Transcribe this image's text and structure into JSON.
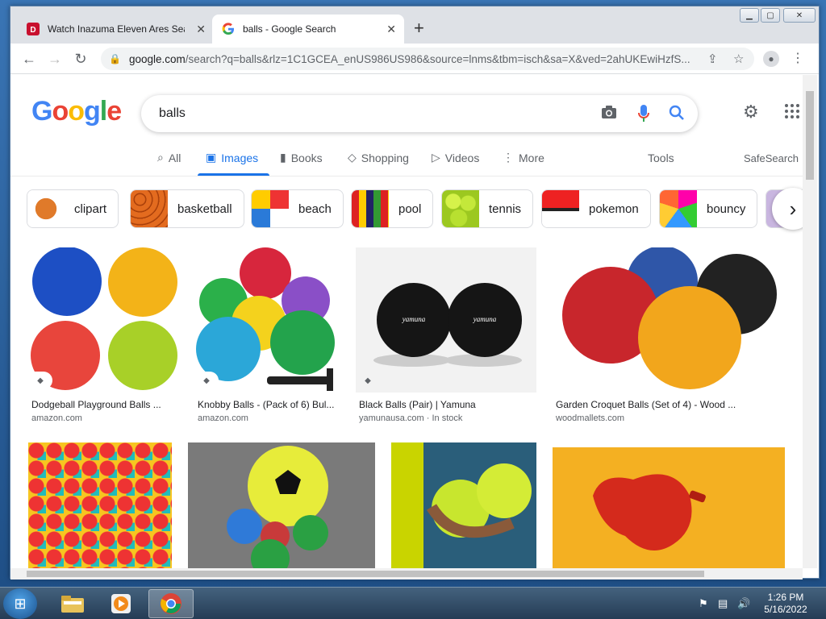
{
  "tabs": [
    {
      "title": "Watch Inazuma Eleven Ares Seas"
    },
    {
      "title": "balls - Google Search"
    }
  ],
  "address_bar": {
    "url_host": "google.com",
    "url_rest": "/search?q=balls&rlz=1C1GCEA_enUS986US986&source=lnms&tbm=isch&sa=X&ved=2ahUKEwiHzfS..."
  },
  "search": {
    "query": "balls"
  },
  "nav_tabs": [
    "All",
    "Images",
    "Books",
    "Shopping",
    "Videos",
    "More"
  ],
  "tools_label": "Tools",
  "safesearch_label": "SafeSearch",
  "chips": [
    "clipart",
    "basketball",
    "beach",
    "pool",
    "tennis",
    "pokemon",
    "bouncy"
  ],
  "results": [
    {
      "title": "Dodgeball Playground Balls ...",
      "source": "amazon.com"
    },
    {
      "title": "Knobby Balls - (Pack of 6) Bul...",
      "source": "amazon.com"
    },
    {
      "title": "Black Balls (Pair) | Yamuna",
      "source": "yamunausa.com · In stock"
    },
    {
      "title": "Garden Croquet Balls (Set of 4) - Wood ...",
      "source": "woodmallets.com"
    }
  ],
  "taskbar": {
    "time": "1:26 PM",
    "date": "5/16/2022"
  },
  "colors": {
    "google_blue": "#4285F4",
    "google_red": "#EA4335",
    "google_yellow": "#FBBC05",
    "google_green": "#34A853",
    "accent": "#1a73e8"
  }
}
